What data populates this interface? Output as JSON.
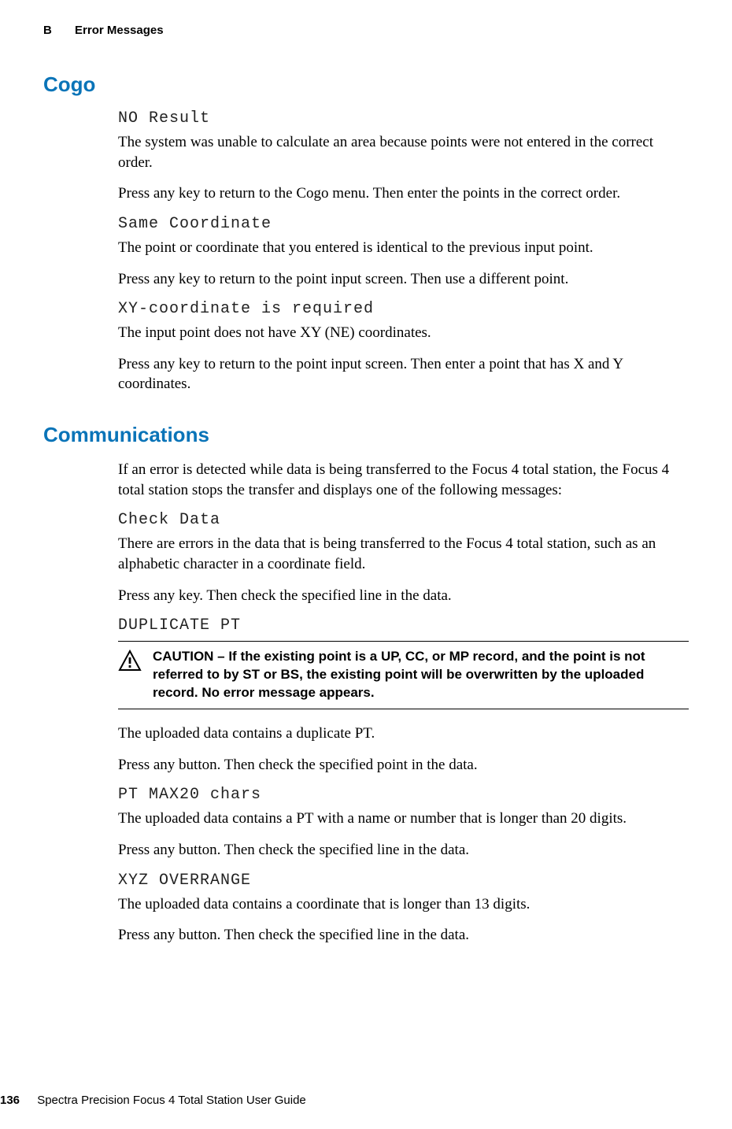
{
  "header": {
    "appendix": "B",
    "title": "Error Messages"
  },
  "sections": {
    "cogo": {
      "heading": "Cogo",
      "items": [
        {
          "code": "NO Result",
          "p1": "The system was unable to calculate an area because points were not entered in the correct order.",
          "p2": "Press any key to return to the Cogo menu. Then enter the points in the correct order."
        },
        {
          "code": "Same Coordinate",
          "p1": "The point or coordinate that you entered is identical to the previous input point.",
          "p2": "Press any key to return to the point input screen. Then use a different point."
        },
        {
          "code": "XY-coordinate is required",
          "p1": "The input point does not have XY (NE) coordinates.",
          "p2": "Press any key to return to the point input screen. Then enter a point that has X and Y coordinates."
        }
      ]
    },
    "comms": {
      "heading": "Communications",
      "intro": "If an error is detected while data is being transferred to the Focus 4 total station, the Focus 4 total station stops the transfer and displays one of the following messages:",
      "items": [
        {
          "code": "Check Data",
          "p1": "There are errors in the data that is being transferred to the Focus 4 total station, such as an alphabetic character in a coordinate field.",
          "p2": "Press any key. Then check the specified line in the data."
        },
        {
          "code": "DUPLICATE PT",
          "caution": "CAUTION – If the existing point is a UP, CC, or MP record, and the point is not referred to by ST or BS, the existing point will be overwritten by the uploaded record. No error message appears.",
          "p1": "The uploaded data contains a duplicate PT.",
          "p2": "Press any button. Then check the specified point in the data."
        },
        {
          "code": "PT MAX20 chars",
          "p1": "The uploaded data contains a PT with a name or number that is longer than 20 digits.",
          "p2": "Press any button. Then check the specified line in the data."
        },
        {
          "code": "XYZ OVERRANGE",
          "p1": "The uploaded data contains a coordinate that is longer than 13 digits.",
          "p2": "Press any button. Then check the specified line in the data."
        }
      ]
    }
  },
  "footer": {
    "page": "136",
    "guide": "Spectra Precision Focus 4 Total Station User Guide"
  }
}
